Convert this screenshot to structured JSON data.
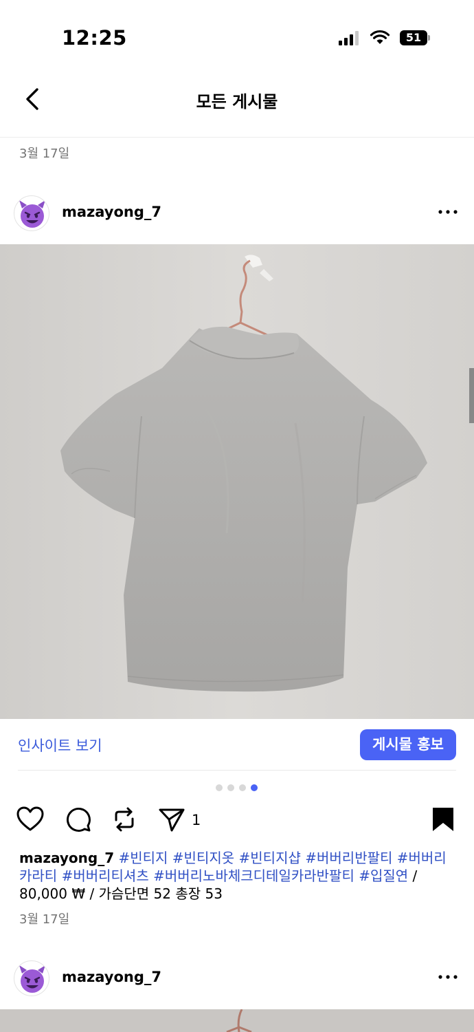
{
  "status_bar": {
    "time": "12:25",
    "battery": "51"
  },
  "nav": {
    "title": "모든 게시물",
    "back_icon": "chevron-left-icon"
  },
  "date_header": "3월 17일",
  "post": {
    "username": "mazayong_7",
    "avatar_icon": "smiling-devil-emoji",
    "insight_label": "인사이트 보기",
    "promote_label": "게시물 홍보",
    "carousel": {
      "total": 4,
      "active": 4
    },
    "share_count": "1",
    "caption": {
      "username": "mazayong_7",
      "hashtags": [
        "#빈티지",
        "#빈티지옷",
        "#빈티지샵",
        "#버버리반팔티",
        "#버버리카라티",
        "#버버리티셔츠",
        "#버버리노바체크디테일카라반팔티",
        "#입질연"
      ],
      "text": "/ 80,000 ₩ / 가슴단면 52 총장 53"
    },
    "date": "3월 17일"
  },
  "next_post": {
    "username": "mazayong_7"
  },
  "colors": {
    "accent": "#4a63f5",
    "hashtag": "#2f4fc4",
    "link": "#3b5bdb",
    "muted": "#737373"
  }
}
